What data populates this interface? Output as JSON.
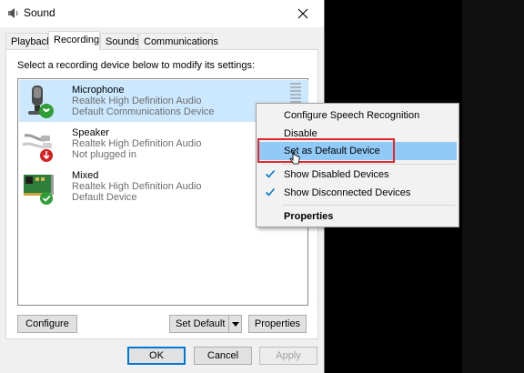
{
  "window": {
    "title": "Sound",
    "tabs": [
      {
        "label": "Playback"
      },
      {
        "label": "Recording"
      },
      {
        "label": "Sounds"
      },
      {
        "label": "Communications"
      }
    ]
  },
  "panel": {
    "instruction": "Select a recording device below to modify its settings:",
    "devices": [
      {
        "name": "Microphone",
        "driver": "Realtek High Definition Audio",
        "status": "Default Communications Device",
        "badge": "phone"
      },
      {
        "name": "Speaker",
        "driver": "Realtek High Definition Audio",
        "status": "Not plugged in",
        "badge": "down-arrow"
      },
      {
        "name": "Mixed",
        "driver": "Realtek High Definition Audio",
        "status": "Default Device",
        "badge": "check"
      }
    ],
    "buttons": {
      "configure": "Configure",
      "set_default": "Set Default",
      "properties": "Properties"
    }
  },
  "footer": {
    "ok": "OK",
    "cancel": "Cancel",
    "apply": "Apply"
  },
  "context_menu": {
    "items": [
      {
        "label": "Configure Speech Recognition"
      },
      {
        "label": "Disable"
      },
      {
        "label": "Set as Default Device"
      },
      {
        "label": "Show Disabled Devices",
        "checked": true
      },
      {
        "label": "Show Disconnected Devices",
        "checked": true
      },
      {
        "label": "Properties"
      }
    ]
  },
  "colors": {
    "selection": "#cce8ff",
    "menu_hover": "#91c9f7",
    "highlight_box": "#e0282e",
    "accent": "#0078d7"
  }
}
